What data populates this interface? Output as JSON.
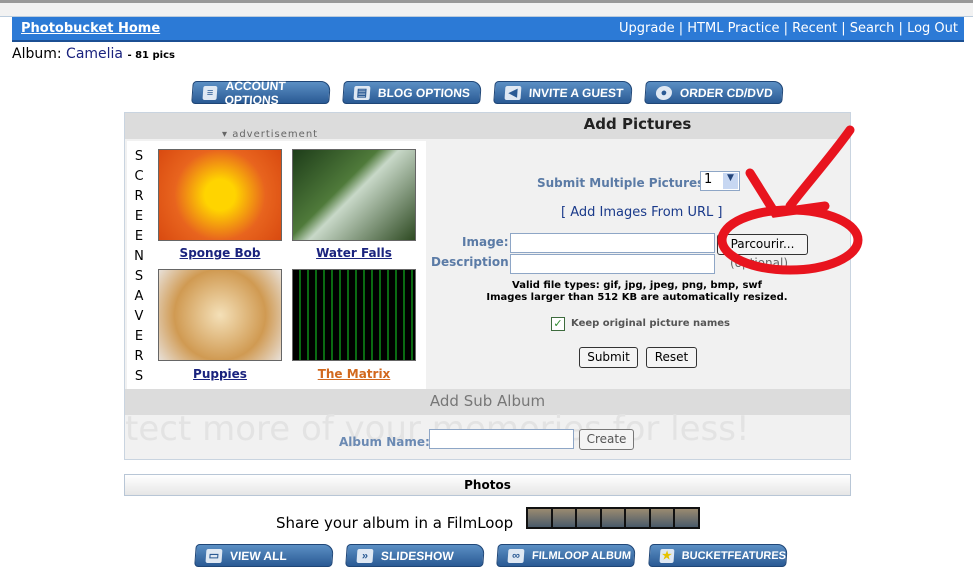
{
  "nav": {
    "home": "Photobucket Home",
    "links": [
      "Upgrade",
      "HTML Practice",
      "Recent",
      "Search",
      "Log Out"
    ]
  },
  "album": {
    "label": "Album:",
    "name": "Camelia",
    "count": "- 81 pics"
  },
  "top_buttons": [
    {
      "label": "ACCOUNT OPTIONS",
      "icon": "document-icon"
    },
    {
      "label": "BLOG OPTIONS",
      "icon": "newspaper-icon"
    },
    {
      "label": "INVITE A GUEST",
      "icon": "megaphone-icon"
    },
    {
      "label": "ORDER CD/DVD",
      "icon": "disc-icon"
    }
  ],
  "add_pictures": {
    "title": "Add Pictures",
    "multiple_label": "Submit Multiple Pictures:",
    "multiple_value": "1",
    "from_url": "[ Add Images From URL ]",
    "image_label": "Image:",
    "browse": "Parcourir...",
    "description_label": "Description:",
    "optional": "(optional)",
    "valid_types": "Valid file types: gif, jpg, jpeg, png, bmp, swf",
    "resize_note": "Images larger than 512 KB are automatically resized.",
    "keep_names": "Keep original picture names",
    "keep_names_checked": true,
    "submit": "Submit",
    "reset": "Reset"
  },
  "ad": {
    "label": "advertisement",
    "vertical": "SCREENSAVERS",
    "items": [
      {
        "caption": "Sponge Bob",
        "color": "#1a237e"
      },
      {
        "caption": "Water Falls",
        "color": "#1a237e"
      },
      {
        "caption": "Puppies",
        "color": "#1a237e"
      },
      {
        "caption": "The Matrix",
        "color": "#d2691e"
      }
    ]
  },
  "sub_album": {
    "title": "Add Sub Album",
    "name_label": "Album Name:",
    "create": "Create"
  },
  "watermark": "tect more of your memories for less!",
  "photos": {
    "title": "Photos"
  },
  "share": "Share your album in a FilmLoop",
  "bottom_buttons": [
    {
      "label": "VIEW ALL",
      "icon": "folder-icon"
    },
    {
      "label": "SLIDESHOW",
      "icon": "fast-forward-icon"
    },
    {
      "label": "FILMLOOP ALBUM",
      "icon": "filmloop-icon"
    },
    {
      "label": "BUCKETFEATURES",
      "icon": "star-icon"
    }
  ],
  "annotation_color": "#e8141e"
}
